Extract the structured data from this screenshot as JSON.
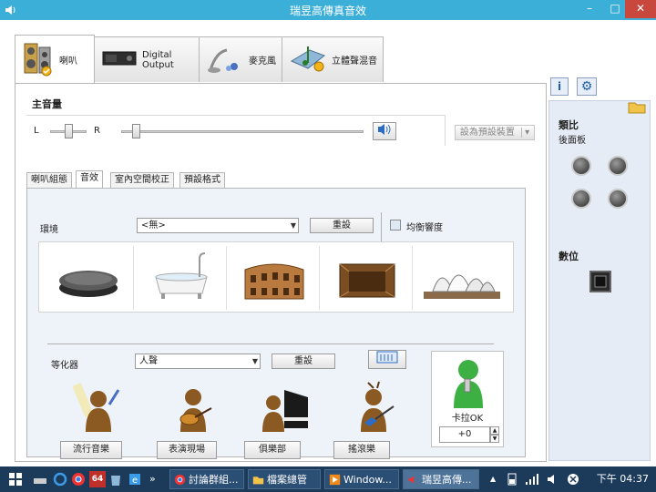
{
  "window": {
    "title": "瑞昱高傳真音效",
    "min_glyph": "–",
    "max_glyph": "□",
    "close_glyph": "✕"
  },
  "device_tabs": [
    {
      "label": "喇叭",
      "icon": "speakers-icon"
    },
    {
      "label": "Digital Output",
      "icon": "digital-output-icon"
    },
    {
      "label": "麥克風",
      "icon": "microphone-icon"
    },
    {
      "label": "立體聲混音",
      "icon": "stereo-mix-icon"
    }
  ],
  "toolbar": {
    "info_glyph": "i",
    "gear_glyph": "⚙"
  },
  "main_volume": {
    "title": "主音量",
    "left_label": "L",
    "right_label": "R",
    "balance": 0.5,
    "level": 0.06
  },
  "set_default": {
    "label": "設為預設裝置",
    "arrow": "▾"
  },
  "sub_tabs": [
    "喇叭組態",
    "音效",
    "室內空間校正",
    "預設格式"
  ],
  "environment": {
    "label": "環境",
    "selected": "<無>",
    "reset_label": "重設",
    "loudness_label": "均衡響度",
    "loudness_checked": false,
    "tiles": [
      "stone-disc-icon",
      "bathtub-icon",
      "colosseum-icon",
      "wooden-room-icon",
      "opera-house-icon"
    ]
  },
  "equalizer": {
    "label": "等化器",
    "selected": "人聲",
    "reset_label": "重設",
    "presets": [
      {
        "label": "流行音樂",
        "icon": "pop-singer-icon"
      },
      {
        "label": "表演現場",
        "icon": "live-guitarist-icon"
      },
      {
        "label": "俱樂部",
        "icon": "club-pianist-icon"
      },
      {
        "label": "搖滾樂",
        "icon": "rock-guitarist-icon"
      }
    ]
  },
  "karaoke": {
    "label": "卡拉OK",
    "value": "+0"
  },
  "analog": {
    "title": "類比",
    "subtitle": "後面板"
  },
  "digital": {
    "title": "數位"
  },
  "taskbar": {
    "items": [
      {
        "label": "討論群組...",
        "icon": "chrome-icon"
      },
      {
        "label": "檔案總管",
        "icon": "folder-icon"
      },
      {
        "label": "Window...",
        "icon": "media-player-icon"
      },
      {
        "label": "瑞昱高傳...",
        "icon": "speaker-icon"
      }
    ],
    "badge": "64",
    "overflow": "»",
    "tray_up": "▲",
    "clock": "下午 04:37"
  },
  "colors": {
    "titlebar": "#3cafd8",
    "accent": "#1f5fa8",
    "taskbar": "#1c3b5a"
  }
}
